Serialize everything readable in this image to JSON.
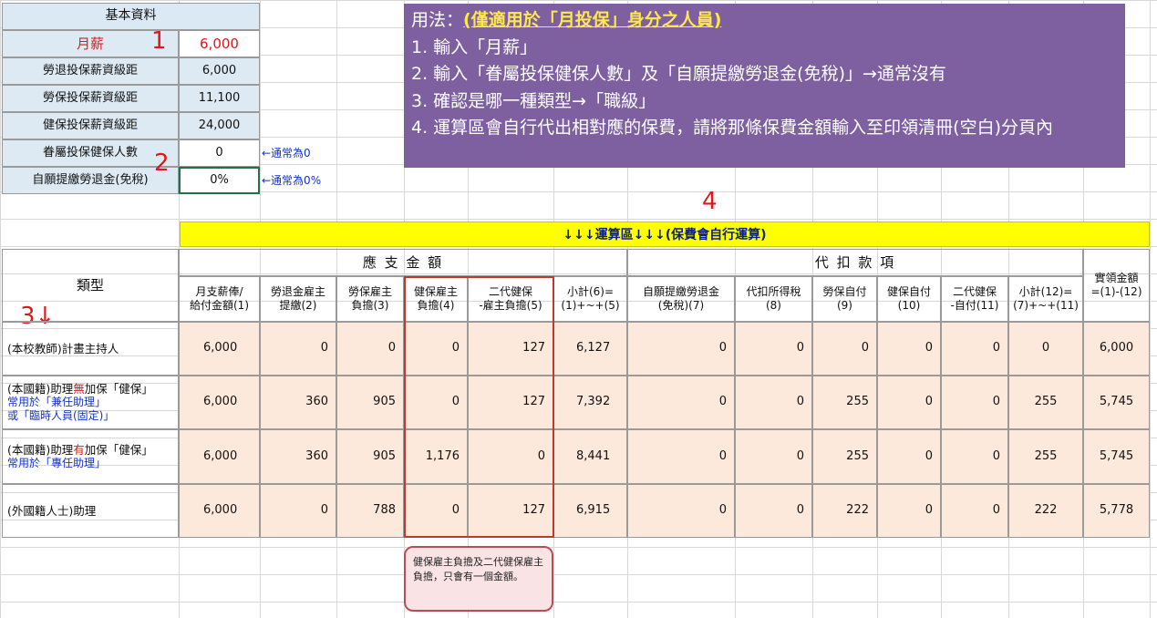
{
  "basic_info": {
    "title": "基本資料",
    "rows": [
      {
        "label": "月薪",
        "value": "6,000"
      },
      {
        "label": "勞退投保薪資級距",
        "value": "6,000"
      },
      {
        "label": "勞保投保薪資級距",
        "value": "11,100"
      },
      {
        "label": "健保投保薪資級距",
        "value": "24,000"
      },
      {
        "label": "眷屬投保健保人數",
        "value": "0"
      },
      {
        "label": "自願提繳勞退金(免稅)",
        "value": "0%"
      }
    ],
    "hint_dependents": "←通常為0",
    "hint_pension": "←通常為0%"
  },
  "markers": {
    "m1": "1",
    "m2": "2",
    "m3": "3↓",
    "m4": "4"
  },
  "instructions": {
    "prefix": "用法：",
    "highlight": "(僅適用於「月投保」身分之人員)",
    "line1": "1. 輸入「月薪」",
    "line2": "2. 輸入「眷屬投保健保人數」及「自願提繳勞退金(免稅)」→通常沒有",
    "line3": "3. 確認是哪一種類型→「職級」",
    "line4": "4. 運算區會自行代出相對應的保費，請將那條保費金額輸入至印領清冊(空白)分頁內"
  },
  "calc_banner": "↓↓↓運算區↓↓↓(保費會自行運算)",
  "table": {
    "type_header": "類型",
    "group_payable": "應 支 金 額",
    "group_deduct": "代 扣 款 項",
    "net_header": "實領金額\n=(1)-(12)",
    "columns": [
      "月支薪俸/\n給付金額(1)",
      "勞退金雇主\n提繳(2)",
      "勞保雇主\n負擔(3)",
      "健保雇主\n負擔(4)",
      "二代健保\n-雇主負擔(5)",
      "小計(6)=\n(1)+~+(5)",
      "自願提繳勞退金\n(免稅)(7)",
      "代扣所得稅\n(8)",
      "勞保自付\n(9)",
      "健保自付\n(10)",
      "二代健保\n-自付(11)",
      "小計(12)=\n(7)+~+(11)"
    ],
    "rows": [
      {
        "type_main": "(本校教師)計畫主持人",
        "type_sub1": "",
        "type_sub2": "",
        "values": [
          "6,000",
          "0",
          "0",
          "0",
          "127",
          "6,127",
          "0",
          "0",
          "0",
          "0",
          "0",
          "0",
          "6,000"
        ]
      },
      {
        "type_main_pre": "(本國籍)助理",
        "type_main_mark": "無",
        "type_main_post": "加保「健保」",
        "type_sub1": "常用於「兼任助理」",
        "type_sub2": "或「臨時人員(固定)」",
        "values": [
          "6,000",
          "360",
          "905",
          "0",
          "127",
          "7,392",
          "0",
          "0",
          "255",
          "0",
          "0",
          "255",
          "5,745"
        ]
      },
      {
        "type_main_pre": "(本國籍)助理",
        "type_main_mark": "有",
        "type_main_post": "加保「健保」",
        "type_sub1": "常用於「專任助理」",
        "type_sub2": "",
        "values": [
          "6,000",
          "360",
          "905",
          "1,176",
          "0",
          "8,441",
          "0",
          "0",
          "255",
          "0",
          "0",
          "255",
          "5,745"
        ]
      },
      {
        "type_main": "(外國籍人士)助理",
        "type_sub1": "",
        "type_sub2": "",
        "values": [
          "6,000",
          "0",
          "788",
          "0",
          "127",
          "6,915",
          "0",
          "0",
          "222",
          "0",
          "0",
          "222",
          "5,778"
        ]
      }
    ]
  },
  "note": "健保雇主負擔及二代健保雇主負擔，只會有一個金額。"
}
